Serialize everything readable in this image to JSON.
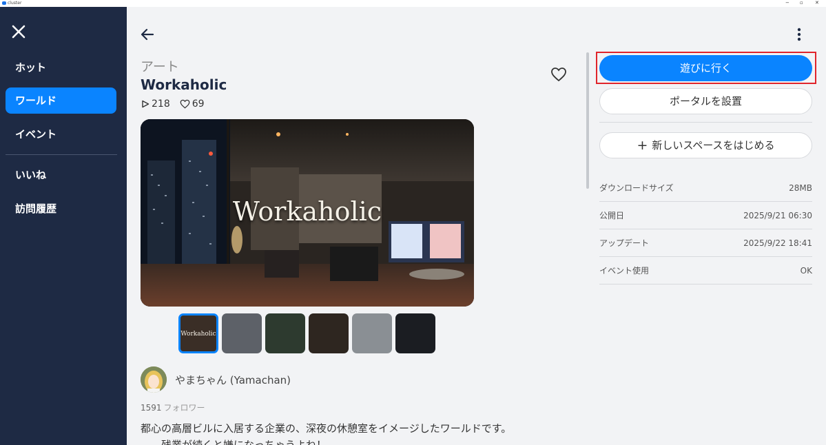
{
  "window": {
    "app_name": "cluster",
    "minimize": "−",
    "restore": "▫",
    "close": "✕"
  },
  "sidebar": {
    "items": [
      {
        "label": "ホット",
        "active": false
      },
      {
        "label": "ワールド",
        "active": true
      },
      {
        "label": "イベント",
        "active": false
      },
      {
        "label": "いいね",
        "active": false
      },
      {
        "label": "訪問履歴",
        "active": false
      }
    ]
  },
  "world": {
    "category": "アート",
    "title": "Workaholic",
    "plays": "218",
    "likes": "69",
    "hero_text": "Workaholic",
    "thumb_label": "Workaholic"
  },
  "author": {
    "name": "やまちゃん (Yamachan)",
    "followers": "1591",
    "followers_unit": "フォロワー"
  },
  "description": {
    "line1": "都心の高層ビルに入居する企業の、深夜の休憩室をイメージしたワールドです。",
    "line2": "……残業が続くと嫌になっちゃうよね！"
  },
  "actions": {
    "play": "遊びに行く",
    "portal": "ポータルを設置",
    "new_space": "新しいスペースをはじめる",
    "new_space_icon": "plus-icon"
  },
  "details": [
    {
      "label": "ダウンロードサイズ",
      "value": "28MB"
    },
    {
      "label": "公開日",
      "value": "2025/9/21 06:30"
    },
    {
      "label": "アップデート",
      "value": "2025/9/22 18:41"
    },
    {
      "label": "イベント使用",
      "value": "OK"
    }
  ],
  "colors": {
    "sidebar_bg": "#1e2a44",
    "accent": "#0a84ff",
    "highlight": "#e0242b",
    "page_bg": "#f2f3f5"
  }
}
